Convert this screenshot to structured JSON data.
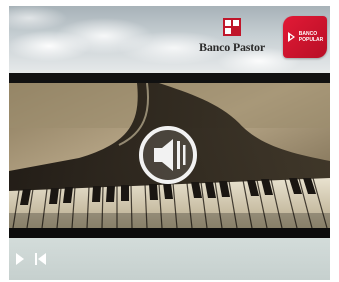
{
  "banner": {
    "brand_primary": "Banco Pastor",
    "brand_secondary_lines": [
      "BANCO",
      "POPULAR"
    ],
    "brand_colors": {
      "pastor_red": "#c0162a",
      "popular_red": "#e21a36"
    }
  },
  "video": {
    "overlay_icon": "speaker-muted-icon",
    "scene": "grand piano keyboard"
  },
  "controls": {
    "play_icon": "play-icon",
    "rewind_icon": "skip-to-start-icon"
  }
}
